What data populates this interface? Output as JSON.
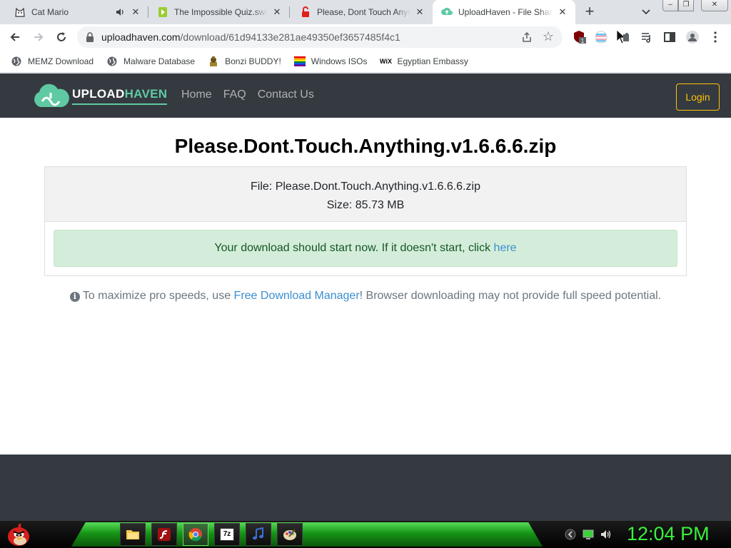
{
  "browser": {
    "tabs": [
      {
        "title": "Cat Mario",
        "favicon": "cat-icon"
      },
      {
        "title": "The Impossible Quiz.swf (",
        "favicon": "green-tag-icon"
      },
      {
        "title": "Please, Dont Touch Anythi",
        "favicon": "red-lock-icon"
      },
      {
        "title": "UploadHaven - File Sharin",
        "favicon": "uploadhaven-icon"
      }
    ],
    "url_domain": "uploadhaven.com",
    "url_path": "/download/61d94133e281ae49350ef3657485f4c1",
    "extension_badge": "1",
    "window_buttons": {
      "minimize": "‒",
      "restore": "❐",
      "close": "✕"
    }
  },
  "bookmarks": [
    {
      "label": "MEMZ Download",
      "icon": "globe-icon"
    },
    {
      "label": "Malware Database",
      "icon": "globe-icon"
    },
    {
      "label": "Bonzi BUDDY!",
      "icon": "bonzi-icon"
    },
    {
      "label": "Windows ISOs",
      "icon": "rainbow-icon"
    },
    {
      "label": "Egyptian Embassy",
      "icon": "wix-icon",
      "icon_text": "WiX"
    }
  ],
  "site": {
    "logo_part1": "UPLOAD",
    "logo_part2": "HAVEN",
    "nav": [
      "Home",
      "FAQ",
      "Contact Us"
    ],
    "login": "Login",
    "file_title": "Please.Dont.Touch.Anything.v1.6.6.6.zip",
    "file_line": "File: Please.Dont.Touch.Anything.v1.6.6.6.zip",
    "size_line": "Size: 85.73 MB",
    "alert_text": "Your download should start now. If it doesn't start, click ",
    "alert_link": "here",
    "tip_prefix": "To maximize pro speeds, use ",
    "tip_link": "Free Download Manager",
    "tip_suffix": "! Browser downloading may not provide full speed potential.",
    "info_glyph": "i",
    "colors": {
      "nav_bg": "#343a40",
      "accent": "#5fc9a3",
      "login": "#ffc107",
      "alert_bg": "#d4edda",
      "link": "#3b8fd0"
    }
  },
  "taskbar": {
    "clock": "12:04 PM",
    "apps": [
      "folder-icon",
      "flash-icon",
      "chrome-icon",
      "sevenzip-icon",
      "music-icon",
      "paint-icon"
    ],
    "sevenzip_label": "7z"
  }
}
